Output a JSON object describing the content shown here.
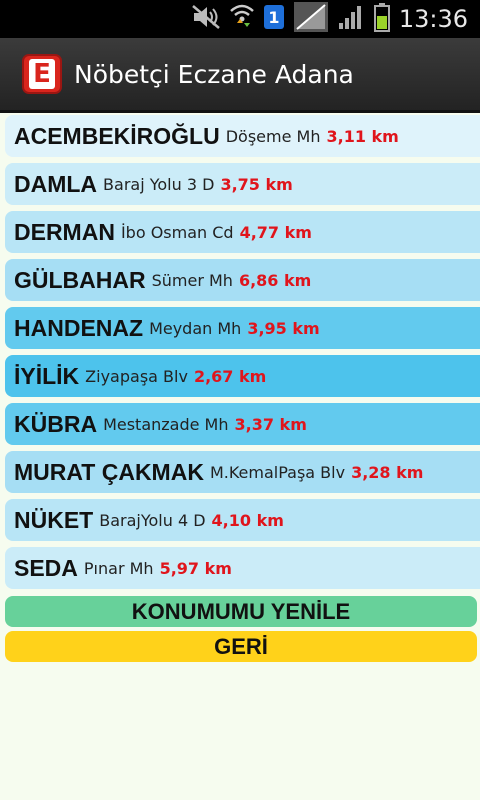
{
  "status_bar": {
    "time": "13:36",
    "icons": [
      "mute-icon",
      "wifi-icon",
      "notification-badge-icon",
      "no-signal-icon",
      "signal-icon",
      "battery-icon"
    ],
    "badge_number": "1"
  },
  "app": {
    "title": "Nöbetçi Eczane Adana",
    "icon_letter": "E",
    "accent_color": "#d9251d"
  },
  "pharmacies": [
    {
      "name": "ACEMBEKİROĞLU",
      "address": "Döşeme Mh",
      "distance": "3,11 km"
    },
    {
      "name": "DAMLA",
      "address": "Baraj Yolu 3 D",
      "distance": "3,75 km"
    },
    {
      "name": "DERMAN",
      "address": "İbo Osman Cd",
      "distance": "4,77 km"
    },
    {
      "name": "GÜLBAHAR",
      "address": "Sümer Mh",
      "distance": "6,86 km"
    },
    {
      "name": "HANDENAZ",
      "address": "Meydan Mh",
      "distance": "3,95 km"
    },
    {
      "name": "İYİLİK",
      "address": "Ziyapaşa Blv",
      "distance": "2,67 km"
    },
    {
      "name": "KÜBRA",
      "address": "Mestanzade Mh",
      "distance": "3,37 km"
    },
    {
      "name": "MURAT ÇAKMAK",
      "address": "M.KemalPaşa Blv",
      "distance": "3,28 km"
    },
    {
      "name": "NÜKET",
      "address": "BarajYolu 4 D",
      "distance": "4,10 km"
    },
    {
      "name": "SEDA",
      "address": "Pınar Mh",
      "distance": "5,97 km"
    }
  ],
  "buttons": {
    "refresh_label": "KONUMUMU YENİLE",
    "back_label": "GERİ"
  }
}
